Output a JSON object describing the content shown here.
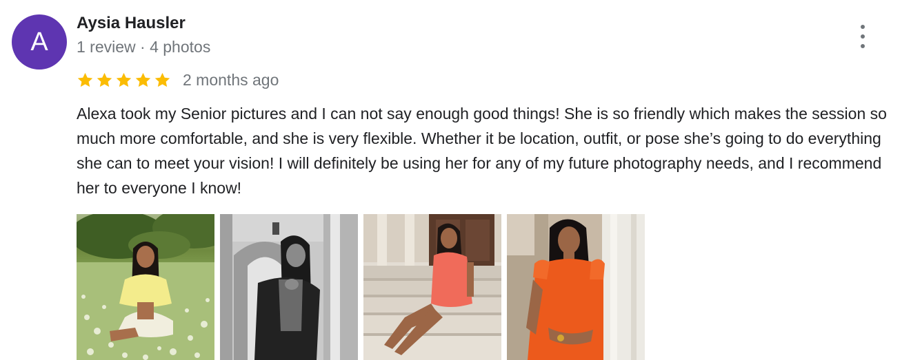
{
  "review": {
    "avatar_letter": "A",
    "avatar_color": "#5e35b1",
    "author_name": "Aysia Hausler",
    "meta": "1 review · 4 photos",
    "rating": 5,
    "rating_max": 5,
    "star_color": "#fbbc04",
    "time_ago": "2 months ago",
    "text": "Alexa took my Senior pictures and I can not say enough good things! She is so friendly which makes the session so much more comfortable, and she is very flexible. Whether it be location, outfit, or pose she’s going to do everything she can to meet your vision! I will definitely be using her for any of my future photography needs, and I recommend her to everyone I know!",
    "more_icon": "more-vert-icon",
    "photo_count": 4
  }
}
